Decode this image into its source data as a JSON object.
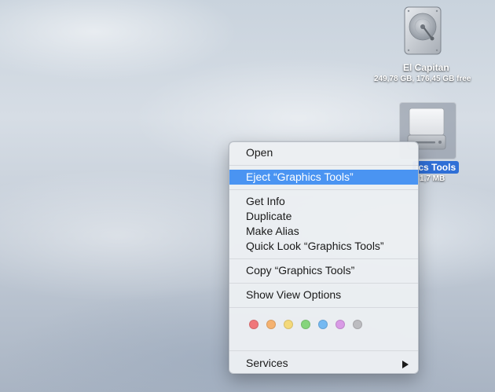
{
  "desktop": {
    "disk1": {
      "name": "El Capitan",
      "info": "249,78 GB, 176,45 GB free",
      "icon": "internal-hard-disk-icon"
    },
    "disk2": {
      "name": "Graphics Tools",
      "name_visible": "ics Tools",
      "info_visible": "1,7 MB",
      "icon": "external-disk-image-icon"
    }
  },
  "context_menu": {
    "open": "Open",
    "eject": "Eject “Graphics Tools”",
    "get_info": "Get Info",
    "duplicate": "Duplicate",
    "make_alias": "Make Alias",
    "quick_look": "Quick Look “Graphics Tools”",
    "copy": "Copy “Graphics Tools”",
    "show_view_options": "Show View Options",
    "services": "Services",
    "highlighted_item": "eject",
    "tag_colors": [
      "#f0777b",
      "#f5b270",
      "#f4d97a",
      "#86d57c",
      "#74b9f2",
      "#d99ae6",
      "#bcbcc0"
    ]
  },
  "colors": {
    "highlight": "#4a94f2",
    "selection_label": "#2f6fd6"
  }
}
